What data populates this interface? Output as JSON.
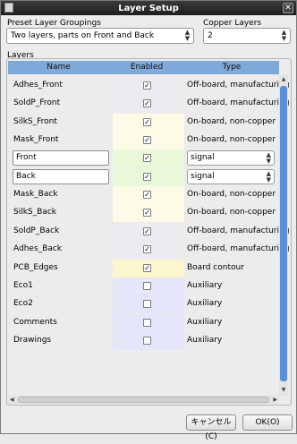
{
  "window": {
    "title": "Layer Setup",
    "close_glyph": "✕"
  },
  "preset": {
    "label": "Preset Layer Groupings",
    "value": "Two layers, parts on Front and Back"
  },
  "copper": {
    "label": "Copper Layers",
    "value": "2"
  },
  "layers": {
    "group_label": "Layers",
    "columns": [
      "Name",
      "Enabled",
      "Type"
    ],
    "rows": [
      {
        "name": "Adhes_Front",
        "enabled": true,
        "type": "Off-board, manufacturing",
        "color": "#ececf0"
      },
      {
        "name": "SoldP_Front",
        "enabled": true,
        "type": "Off-board, manufacturing",
        "color": "#ececf0"
      },
      {
        "name": "SilkS_Front",
        "enabled": true,
        "type": "On-board, non-copper",
        "color": "#fdfbe8"
      },
      {
        "name": "Mask_Front",
        "enabled": true,
        "type": "On-board, non-copper",
        "color": "#fdfbe8"
      },
      {
        "name": "Front",
        "enabled": true,
        "type": "signal",
        "editable": true,
        "color": "#e8f8d8"
      },
      {
        "name": "Back",
        "enabled": true,
        "type": "signal",
        "editable": true,
        "color": "#e8f8d8"
      },
      {
        "name": "Mask_Back",
        "enabled": true,
        "type": "On-board, non-copper",
        "color": "#fdfbe8"
      },
      {
        "name": "SilkS_Back",
        "enabled": true,
        "type": "On-board, non-copper",
        "color": "#fdfbe8"
      },
      {
        "name": "SoldP_Back",
        "enabled": true,
        "type": "Off-board, manufacturing",
        "color": "#ececf0"
      },
      {
        "name": "Adhes_Back",
        "enabled": true,
        "type": "Off-board, manufacturing",
        "color": "#ececf0"
      },
      {
        "name": "PCB_Edges",
        "enabled": true,
        "type": "Board contour",
        "color": "#fdf6cc"
      },
      {
        "name": "Eco1",
        "enabled": false,
        "type": "Auxiliary",
        "color": "#e6e6fb"
      },
      {
        "name": "Eco2",
        "enabled": false,
        "type": "Auxiliary",
        "color": "#e6e6fb"
      },
      {
        "name": "Comments",
        "enabled": false,
        "type": "Auxiliary",
        "color": "#e6e6fb"
      },
      {
        "name": "Drawings",
        "enabled": false,
        "type": "Auxiliary",
        "color": "#e6e6fb"
      }
    ]
  },
  "buttons": {
    "cancel": "キャンセル(C)",
    "ok": "OK(O)"
  },
  "glyphs": {
    "check": "✓",
    "up": "▲",
    "down": "▼",
    "left": "◀",
    "right": "▶"
  }
}
